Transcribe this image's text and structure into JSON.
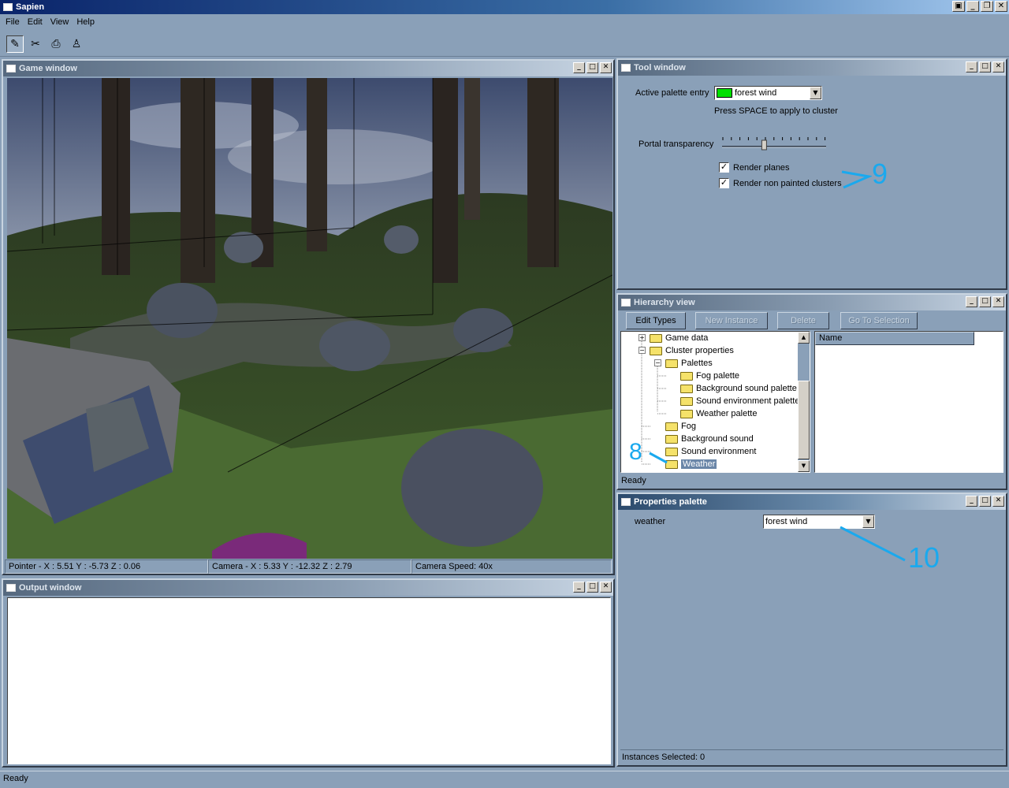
{
  "app": {
    "title": "Sapien"
  },
  "menu": [
    "File",
    "Edit",
    "View",
    "Help"
  ],
  "toolbar": {
    "tools": [
      "pencil-icon",
      "scissors-icon",
      "camera-icon",
      "person-icon"
    ]
  },
  "game_window": {
    "title": "Game window",
    "status": {
      "pointer": "Pointer - X : 5.51  Y : -5.73  Z : 0.06",
      "camera": "Camera - X : 5.33  Y : -12.32  Z : 2.79",
      "speed": "Camera Speed: 40x"
    }
  },
  "output_window": {
    "title": "Output window"
  },
  "tool_window": {
    "title": "Tool window",
    "palette_label": "Active palette entry",
    "palette_value": "forest wind",
    "palette_swatch": "#00e000",
    "hint": "Press SPACE to apply to cluster",
    "portal_label": "Portal transparency",
    "portal_value": 0.4,
    "render_planes": "Render planes",
    "render_non_painted": "Render non painted clusters"
  },
  "hierarchy": {
    "title": "Hierarchy view",
    "buttons": {
      "edit_types": "Edit Types",
      "new_instance": "New Instance",
      "delete": "Delete",
      "goto": "Go To Selection"
    },
    "tree": [
      "Game data",
      "Cluster properties",
      "Palettes",
      "Fog palette",
      "Background sound palette",
      "Sound environment palette",
      "Weather palette",
      "Fog",
      "Background sound",
      "Sound environment",
      "Weather"
    ],
    "list_header": "Name",
    "status": "Ready"
  },
  "properties": {
    "title": "Properties palette",
    "field_label": "weather",
    "field_value": "forest wind",
    "status": "Instances Selected: 0"
  },
  "annotations": {
    "a8": "8",
    "a9": "9",
    "a10": "10"
  },
  "statusbar": "Ready",
  "colors": {
    "annotation": "#1aa9ee",
    "background": "#8aa0b8"
  }
}
